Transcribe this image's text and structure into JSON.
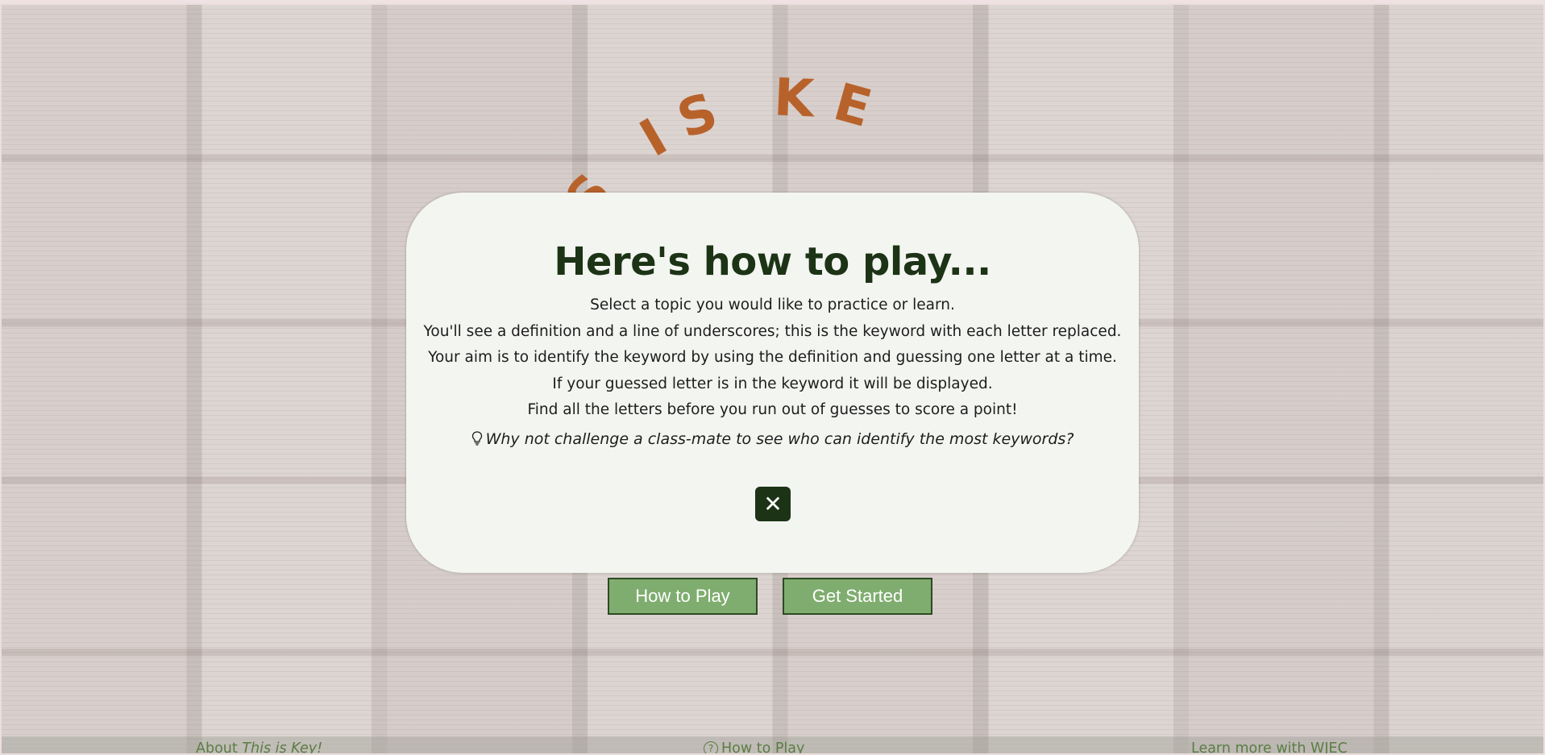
{
  "app": {
    "title_arc_visible": "IS IS KE"
  },
  "modal": {
    "heading": "Here's how to play...",
    "lines": [
      "Select a topic you would like to practice or learn.",
      "You'll see a definition and a line of underscores; this is the keyword with each letter replaced.",
      "Your aim is to identify the keyword by using the definition and guessing one letter at a time.",
      "If your guessed letter is in the keyword it will be displayed.",
      "Find all the letters before you run out of guesses to score a point!"
    ],
    "tip": "Why not challenge a class-mate to see who can identify the most keywords?",
    "close_icon": "close-icon"
  },
  "buttons": {
    "how_to_play": "How to Play",
    "get_started": "Get Started"
  },
  "footer": {
    "about_prefix": "About ",
    "about_name": "This is Key!",
    "how_to_play": "How to Play",
    "learn_more": "Learn more with WJEC"
  },
  "colors": {
    "brand_orange": "#b8622b",
    "dark_green": "#1c3316",
    "button_green": "#7fad6f",
    "footer_green": "#5a7d44"
  }
}
